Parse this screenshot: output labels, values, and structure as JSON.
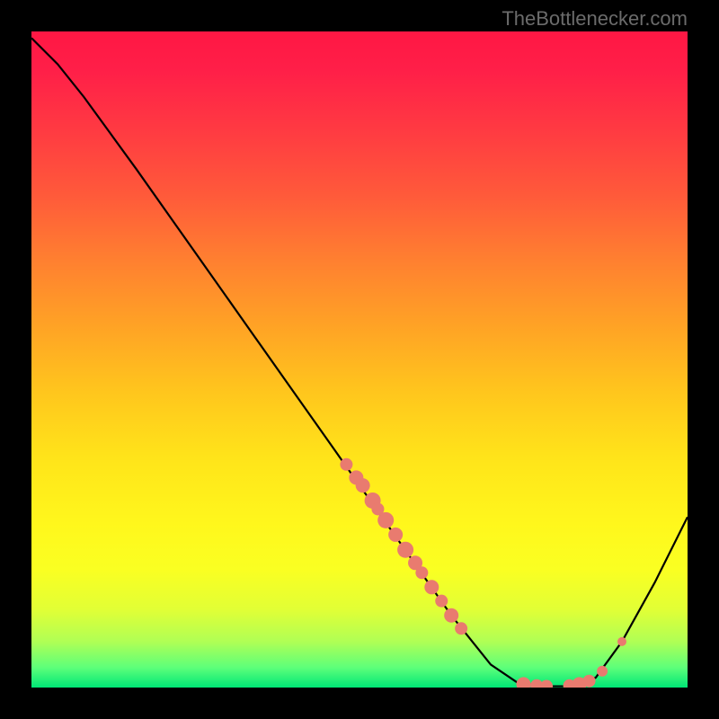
{
  "watermark": "TheBottlenecker.com",
  "chart_data": {
    "type": "line",
    "title": "",
    "xlabel": "",
    "ylabel": "",
    "xlim": [
      0,
      100
    ],
    "ylim": [
      0,
      100
    ],
    "grid": false,
    "background": "red-yellow-green vertical gradient (red top, green bottom)",
    "curve": {
      "description": "Bottleneck curve: starts high top-left, descends with slight bend, reaches minimum (~0) around x=78-85, rises toward right edge",
      "points": [
        {
          "x": 0.0,
          "y": 99.0
        },
        {
          "x": 4.0,
          "y": 95.0
        },
        {
          "x": 8.0,
          "y": 90.0
        },
        {
          "x": 12.0,
          "y": 84.5
        },
        {
          "x": 16.0,
          "y": 79.0
        },
        {
          "x": 22.0,
          "y": 70.5
        },
        {
          "x": 28.0,
          "y": 62.0
        },
        {
          "x": 34.0,
          "y": 53.5
        },
        {
          "x": 40.0,
          "y": 45.0
        },
        {
          "x": 46.0,
          "y": 36.5
        },
        {
          "x": 52.0,
          "y": 28.0
        },
        {
          "x": 58.0,
          "y": 19.5
        },
        {
          "x": 64.0,
          "y": 11.0
        },
        {
          "x": 70.0,
          "y": 3.5
        },
        {
          "x": 74.0,
          "y": 0.8
        },
        {
          "x": 78.0,
          "y": 0.2
        },
        {
          "x": 82.0,
          "y": 0.2
        },
        {
          "x": 86.0,
          "y": 1.5
        },
        {
          "x": 90.0,
          "y": 7.0
        },
        {
          "x": 95.0,
          "y": 16.0
        },
        {
          "x": 100.0,
          "y": 26.0
        }
      ]
    },
    "scatter": {
      "description": "Salmon-colored data points along the curve, clustered in two regions",
      "color": "#e97b6f",
      "points": [
        {
          "x": 48.0,
          "y": 34.0,
          "r": 7
        },
        {
          "x": 49.5,
          "y": 32.0,
          "r": 8
        },
        {
          "x": 50.5,
          "y": 30.8,
          "r": 8
        },
        {
          "x": 52.0,
          "y": 28.5,
          "r": 9
        },
        {
          "x": 52.8,
          "y": 27.2,
          "r": 7
        },
        {
          "x": 54.0,
          "y": 25.5,
          "r": 9
        },
        {
          "x": 55.5,
          "y": 23.3,
          "r": 8
        },
        {
          "x": 57.0,
          "y": 21.0,
          "r": 9
        },
        {
          "x": 58.5,
          "y": 19.0,
          "r": 8
        },
        {
          "x": 59.5,
          "y": 17.5,
          "r": 7
        },
        {
          "x": 61.0,
          "y": 15.3,
          "r": 8
        },
        {
          "x": 62.5,
          "y": 13.2,
          "r": 7
        },
        {
          "x": 64.0,
          "y": 11.0,
          "r": 8
        },
        {
          "x": 65.5,
          "y": 9.0,
          "r": 7
        },
        {
          "x": 75.0,
          "y": 0.5,
          "r": 8
        },
        {
          "x": 77.0,
          "y": 0.3,
          "r": 7
        },
        {
          "x": 78.5,
          "y": 0.2,
          "r": 7
        },
        {
          "x": 82.0,
          "y": 0.3,
          "r": 7
        },
        {
          "x": 83.5,
          "y": 0.5,
          "r": 8
        },
        {
          "x": 85.0,
          "y": 1.0,
          "r": 7
        },
        {
          "x": 87.0,
          "y": 2.5,
          "r": 6
        },
        {
          "x": 90.0,
          "y": 7.0,
          "r": 5
        }
      ]
    }
  }
}
